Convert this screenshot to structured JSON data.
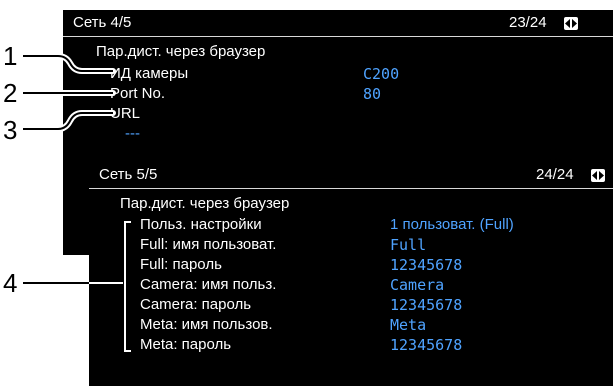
{
  "callouts": [
    "1",
    "2",
    "3",
    "4"
  ],
  "screen1": {
    "title": "Сеть 4/5",
    "page": "23/24",
    "section": "Пар.дист. через браузер",
    "rows": [
      {
        "label": "ИД камеры",
        "value": "C200"
      },
      {
        "label": "Port No.",
        "value": "80"
      },
      {
        "label": "URL",
        "value": "---"
      }
    ]
  },
  "screen2": {
    "title": "Сеть 5/5",
    "page": "24/24",
    "section": "Пар.дист. через браузер",
    "rows": [
      {
        "label": "Польз. настройки",
        "value": "1 пользоват. (Full)"
      },
      {
        "label": "Full: имя пользоват.",
        "value": "Full"
      },
      {
        "label": "Full: пароль",
        "value": "12345678"
      },
      {
        "label": "Camera: имя польз.",
        "value": "Camera"
      },
      {
        "label": "Camera: пароль",
        "value": "12345678"
      },
      {
        "label": "Meta: имя пользов.",
        "value": "Meta"
      },
      {
        "label": "Meta: пароль",
        "value": "12345678"
      }
    ]
  },
  "colors": {
    "screen_bg": "#000000",
    "text": "#ffffff",
    "value": "#4fa3ff",
    "callout": "#000000"
  },
  "icons": {
    "page_nav": "left-right-arrows-icon"
  }
}
